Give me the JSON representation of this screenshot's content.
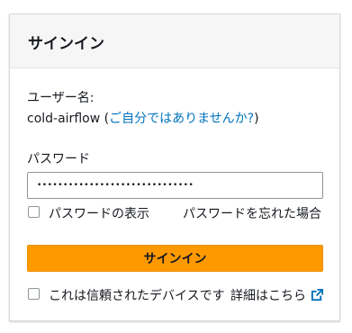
{
  "header": {
    "title": "サインイン"
  },
  "user": {
    "label": "ユーザー名:",
    "name": "cold-airflow",
    "open_paren": " (",
    "not_you_link": "ご自分ではありませんか?",
    "close_paren": ")"
  },
  "password": {
    "label": "パスワード",
    "masked_value": "••••••••••••••••••••••••••••••",
    "show_label": "パスワードの表示",
    "show_checked": false,
    "forgot_link": "パスワードを忘れた場合"
  },
  "actions": {
    "signin_label": "サインイン"
  },
  "trust": {
    "label": "これは信頼されたデバイスです",
    "checked": false,
    "details_link": "詳細はこちら",
    "details_icon": "external-link-icon"
  },
  "colors": {
    "accent_button": "#ff9900",
    "link": "#0073bb",
    "header_bg": "#f6f6f6"
  }
}
